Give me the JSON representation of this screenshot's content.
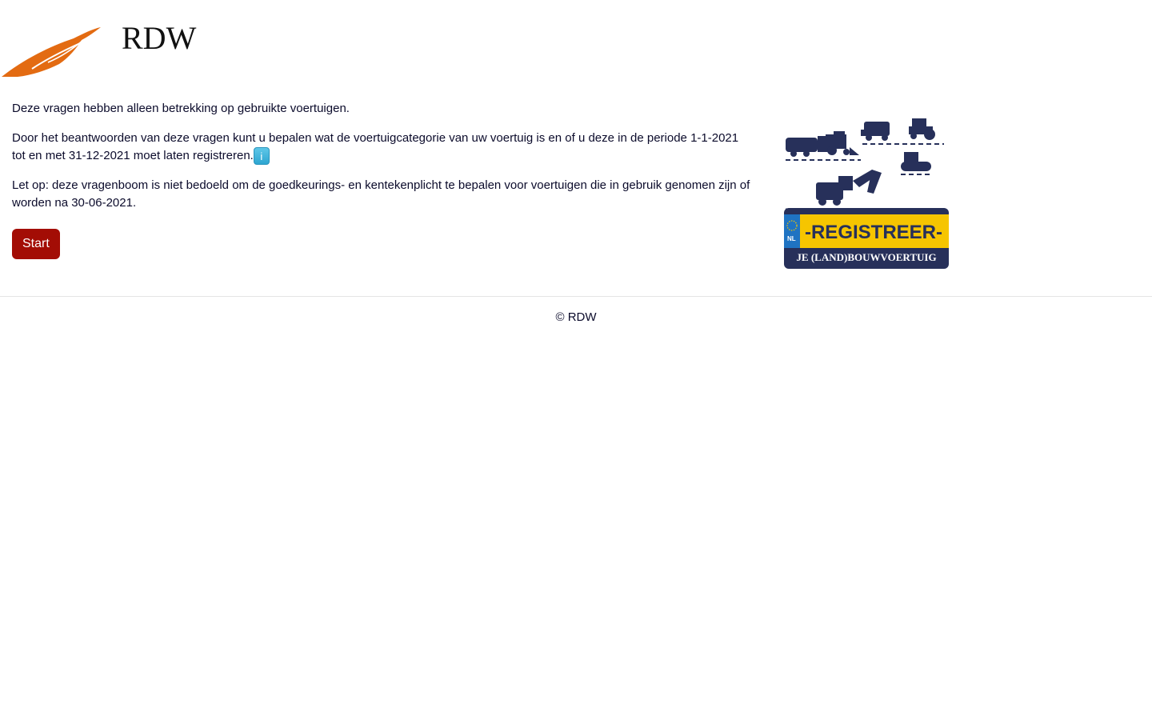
{
  "brand": {
    "name": "RDW",
    "logo_color": "#e36b12"
  },
  "main": {
    "intro": "Deze vragen hebben alleen betrekking op gebruikte voertuigen.",
    "description": "Door het beantwoorden van deze vragen kunt u bepalen wat de voertuigcategorie van uw voertuig is en of u deze in de periode 1-1-2021 tot en met 31-12-2021 moet laten registreren.",
    "info_label": "i",
    "note": "Let op: deze vragenboom is niet bedoeld om de goedkeurings- en kentekenplicht te bepalen voor voertuigen die in gebruik genomen zijn of worden na 30-06-2021.",
    "start_label": "Start",
    "start_color": "#a30d05"
  },
  "promo": {
    "plate_text": "-REGISTREER-",
    "country": "NL",
    "tagline": "JE (LAND)BOUWVOERTUIG",
    "plate_color": "#f6c500",
    "navy": "#27305a",
    "icons": [
      "truck-icon",
      "tractor-icon",
      "harvester-icon",
      "crawler-icon",
      "excavator-icon"
    ]
  },
  "footer": {
    "copyright": "© RDW"
  }
}
